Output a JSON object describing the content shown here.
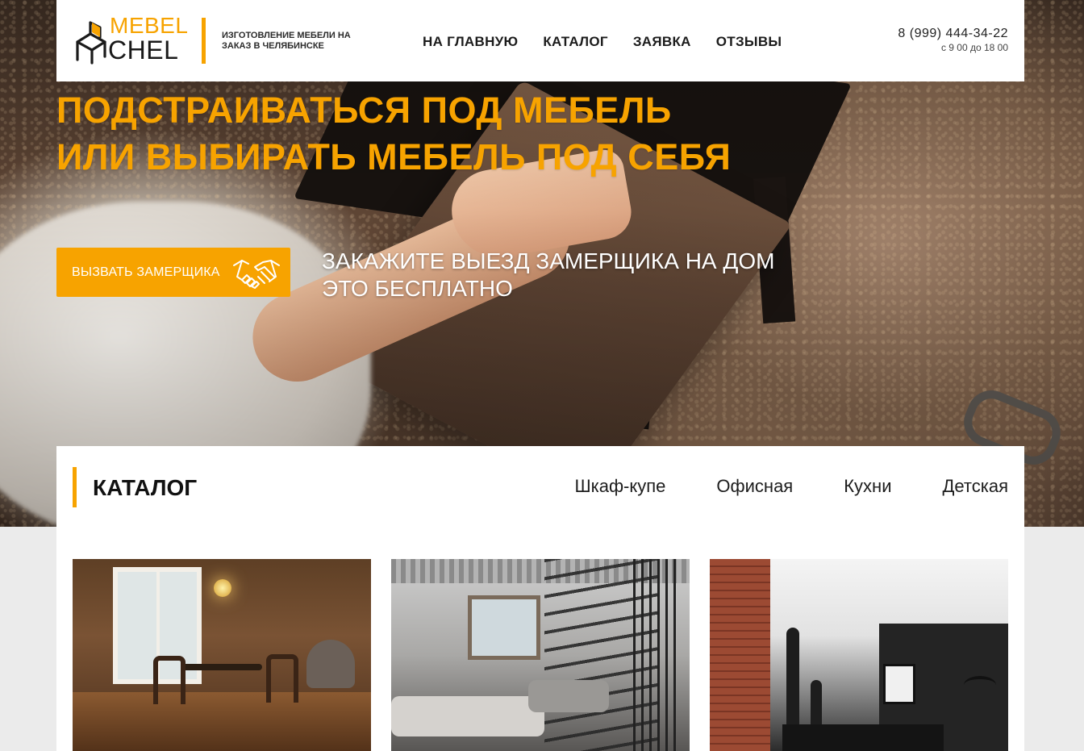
{
  "header": {
    "logo": {
      "word1": "MEBEL",
      "word2": "CHEL",
      "icon": "chair-icon"
    },
    "tagline": "ИЗГОТОВЛЕНИЕ МЕБЕЛИ НА ЗАКАЗ В ЧЕЛЯБИНСКЕ",
    "nav": [
      {
        "label": "НА ГЛАВНУЮ"
      },
      {
        "label": "КАТАЛОГ"
      },
      {
        "label": "ЗАЯВКА"
      },
      {
        "label": "ОТЗЫВЫ"
      }
    ],
    "phone": "8 (999) 444-34-22",
    "hours": "с 9 00 до 18 00"
  },
  "hero": {
    "headline_line1": "ПОДСТРАИВАТЬСЯ ПОД МЕБЕЛЬ",
    "headline_line2": "ИЛИ ВЫБИРАТЬ МЕБЕЛЬ ПОД СЕБЯ",
    "cta_label": "ВЫЗВАТЬ ЗАМЕРЩИКА",
    "cta_icon": "handshake-icon",
    "note_line1": "ЗАКАЖИТЕ ВЫЕЗД ЗАМЕРЩИКА НА ДОМ",
    "note_line2": "ЭТО БЕСПЛАТНО"
  },
  "catalog": {
    "title": "КАТАЛОГ",
    "tabs": [
      {
        "label": "Шкаф-купе"
      },
      {
        "label": "Офисная"
      },
      {
        "label": "Кухни"
      },
      {
        "label": "Детская"
      }
    ]
  },
  "colors": {
    "accent": "#f7a300",
    "text_dark": "#1c1c1c",
    "panel": "#ffffff",
    "page_bg": "#ebebeb"
  }
}
